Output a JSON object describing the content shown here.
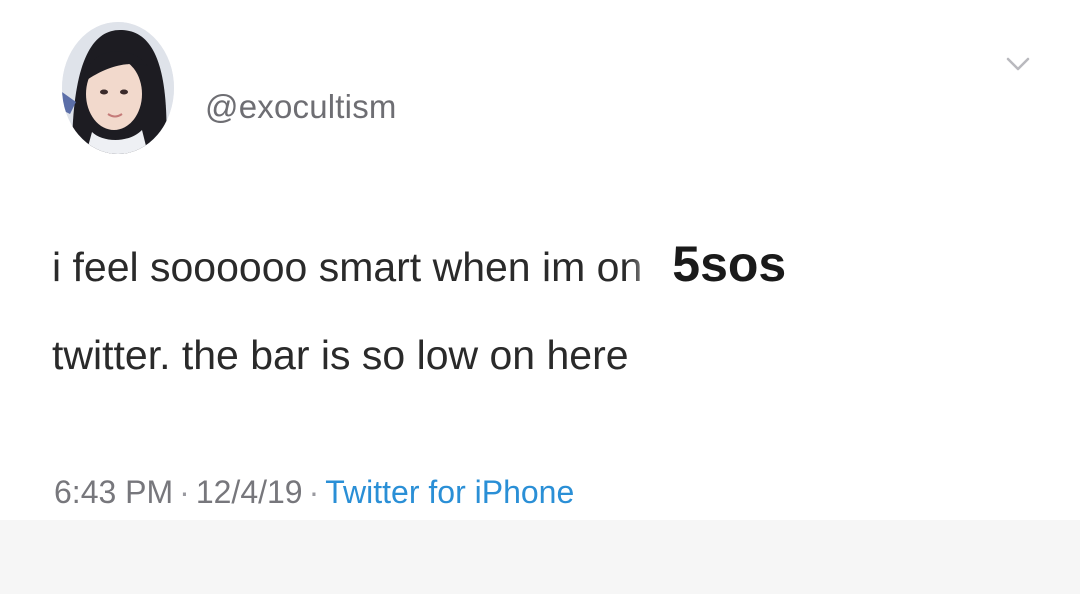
{
  "tweet": {
    "handle": "@exocultism",
    "avatar_icon": "profile-photo",
    "menu_icon": "chevron-down-icon",
    "text_line1": "i feel soooooo smart when im on",
    "text_edit": "5sos",
    "text_line2": "twitter. the bar is so low on here",
    "time": "6:43 PM",
    "separator": "·",
    "date": "12/4/19",
    "source": "Twitter for iPhone"
  },
  "colors": {
    "text": "#2a2a2a",
    "meta": "#77777c",
    "link": "#2a8fd6",
    "background": "#ffffff",
    "bottom_strip": "#f6f6f6"
  }
}
